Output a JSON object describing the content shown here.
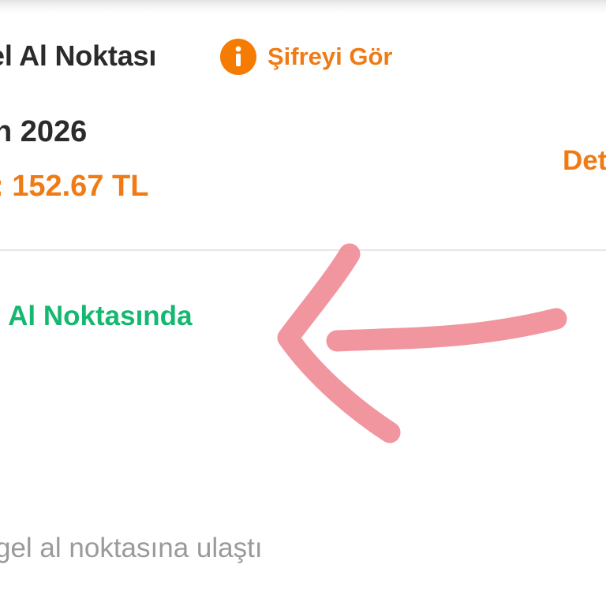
{
  "delivery": {
    "title": "el Al Noktası",
    "info_link": "Şifreyi Gör",
    "date": "n 2026",
    "amount_prefix": ":",
    "amount": "152.67 TL",
    "detail_link": "Det"
  },
  "status": {
    "label": "l Al Noktasında",
    "note": "gel al noktasına ulaştı"
  },
  "colors": {
    "accent": "#f07b14",
    "info_icon": "#f57c00",
    "status_green": "#14b870",
    "text_dark": "#2b2b2b",
    "text_muted": "#9a9a9a",
    "annotation_arrow": "#f08a94"
  },
  "icons": {
    "info": "info-circle-icon"
  }
}
